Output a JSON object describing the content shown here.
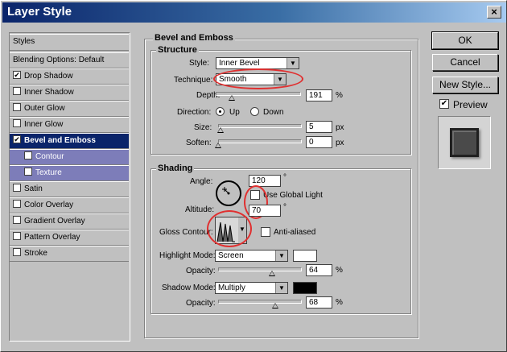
{
  "window": {
    "title": "Layer Style",
    "close_glyph": "×"
  },
  "left_panel": {
    "items": [
      {
        "label": "Styles",
        "kind": "header"
      },
      {
        "label": "Blending Options: Default",
        "kind": "header"
      },
      {
        "label": "Drop Shadow",
        "checked": true
      },
      {
        "label": "Inner Shadow",
        "checked": false
      },
      {
        "label": "Outer Glow",
        "checked": false
      },
      {
        "label": "Inner Glow",
        "checked": false
      },
      {
        "label": "Bevel and Emboss",
        "checked": true,
        "selected": true
      },
      {
        "label": "Contour",
        "checked": false,
        "sub": true
      },
      {
        "label": "Texture",
        "checked": false,
        "sub": true
      },
      {
        "label": "Satin",
        "checked": false
      },
      {
        "label": "Color Overlay",
        "checked": false
      },
      {
        "label": "Gradient Overlay",
        "checked": false
      },
      {
        "label": "Pattern Overlay",
        "checked": false
      },
      {
        "label": "Stroke",
        "checked": false
      }
    ]
  },
  "bevel": {
    "group_title": "Bevel and Emboss",
    "structure": {
      "title": "Structure",
      "style_label": "Style:",
      "style_value": "Inner Bevel",
      "technique_label": "Technique:",
      "technique_value": "Smooth",
      "depth_label": "Depth:",
      "depth_value": "191",
      "depth_unit": "%",
      "depth_slider": 0.19,
      "direction_label": "Direction:",
      "dir_up": "Up",
      "dir_down": "Down",
      "size_label": "Size:",
      "size_value": "5",
      "size_unit": "px",
      "size_slider": 0.03,
      "soften_label": "Soften:",
      "soften_value": "0",
      "soften_unit": "px",
      "soften_slider": 0.0
    },
    "shading": {
      "title": "Shading",
      "angle_label": "Angle:",
      "angle_value": "120",
      "deg": "°",
      "use_global_light": "Use Global Light",
      "altitude_label": "Altitude:",
      "altitude_value": "70",
      "gloss_label": "Gloss Contour:",
      "anti_aliased": "Anti-aliased",
      "highlight_label": "Highlight Mode:",
      "highlight_value": "Screen",
      "highlight_color": "#ffffff",
      "h_opacity_label": "Opacity:",
      "h_opacity_value": "64",
      "h_opacity_unit": "%",
      "h_opacity_slider": 0.64,
      "shadow_label": "Shadow Mode:",
      "shadow_value": "Multiply",
      "shadow_color": "#000000",
      "s_opacity_label": "Opacity:",
      "s_opacity_value": "68",
      "s_opacity_unit": "%",
      "s_opacity_slider": 0.68
    }
  },
  "buttons": {
    "ok": "OK",
    "cancel": "Cancel",
    "new_style": "New Style...",
    "preview": "Preview"
  }
}
